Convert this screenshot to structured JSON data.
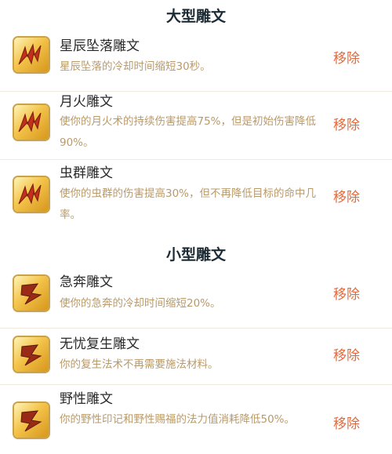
{
  "major": {
    "title": "大型雕文",
    "items": [
      {
        "name": "星辰坠落雕文",
        "desc": "星辰坠落的冷却时间缩短30秒。",
        "action": "移除"
      },
      {
        "name": "月火雕文",
        "desc": "使你的月火术的持续伤害提高75%，但是初始伤害降低90%。",
        "action": "移除"
      },
      {
        "name": "虫群雕文",
        "desc": "使你的虫群的伤害提高30%，但不再降低目标的命中几率。",
        "action": "移除"
      }
    ]
  },
  "minor": {
    "title": "小型雕文",
    "items": [
      {
        "name": "急奔雕文",
        "desc": "使你的急奔的冷却时间缩短20%。",
        "action": "移除"
      },
      {
        "name": "无忧复生雕文",
        "desc": "你的复生法术不再需要施法材料。",
        "action": "移除"
      },
      {
        "name": "野性雕文",
        "desc": "你的野性印记和野性赐福的法力值消耗降低50%。",
        "action": "移除"
      }
    ]
  },
  "icons": {
    "major": "major-glyph-icon",
    "minor": "minor-glyph-icon"
  },
  "colors": {
    "action": "#e26a3c",
    "desc": "#b89a6a",
    "title": "#1b2a33"
  }
}
